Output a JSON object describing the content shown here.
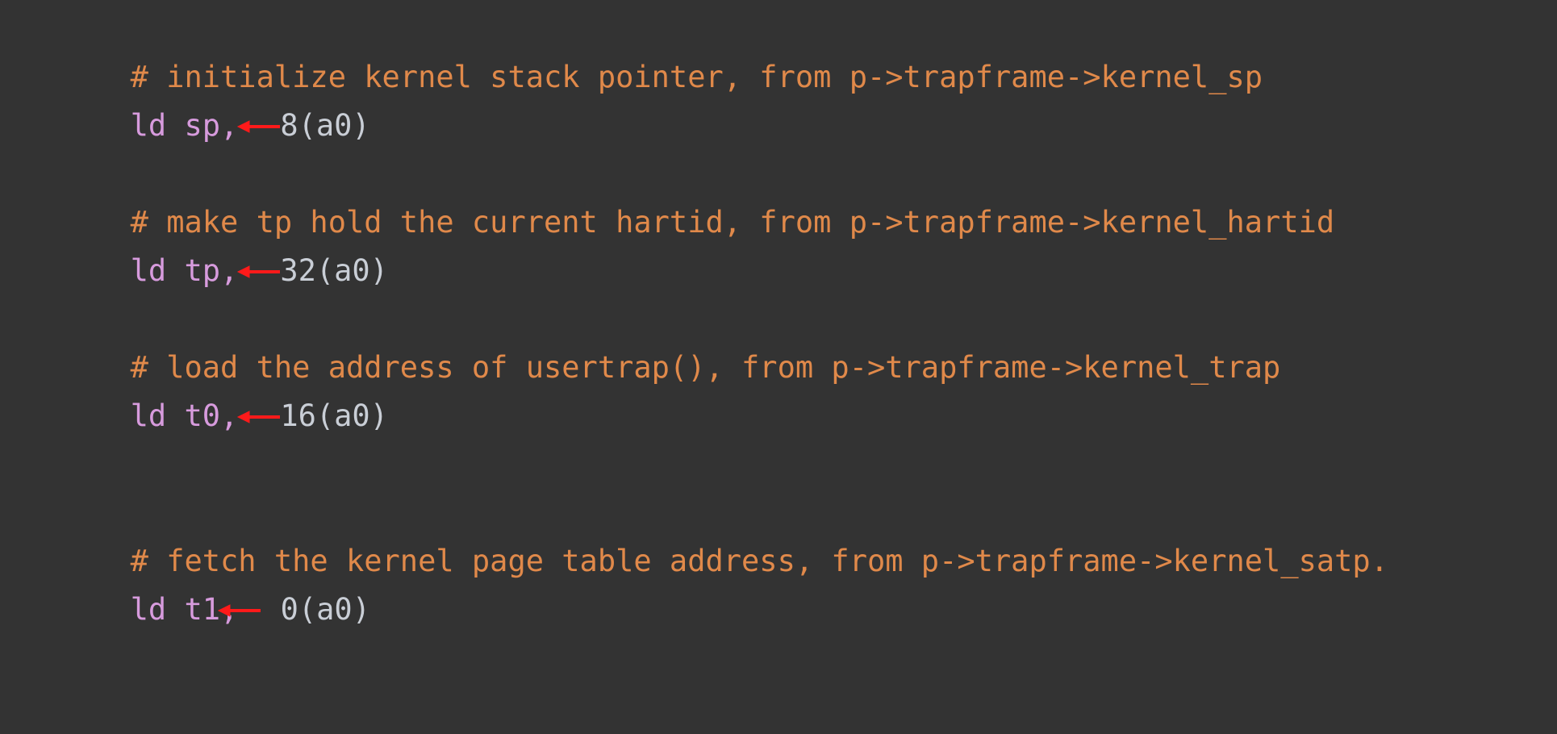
{
  "editor": {
    "background_color": "#333333",
    "comment_color": "#e0894a",
    "keyword_color": "#d79bdd",
    "operand_color": "#c9ced6",
    "annotation_color": "#ff1a1a",
    "language": "riscv-assembly"
  },
  "lines": [
    {
      "id": "line-1",
      "type": "comment",
      "text": "# initialize kernel stack pointer, from p->trapframe->kernel_sp"
    },
    {
      "id": "line-2",
      "type": "code",
      "keyword": "ld ",
      "register": "sp,",
      "operand": "8(a0)",
      "arrow": true,
      "full_text": "ld sp, 8(a0)"
    },
    {
      "id": "line-3",
      "type": "blank",
      "text": ""
    },
    {
      "id": "line-4",
      "type": "comment",
      "text": "# make tp hold the current hartid, from p->trapframe->kernel_hartid"
    },
    {
      "id": "line-5",
      "type": "code",
      "keyword": "ld ",
      "register": "tp,",
      "operand": "32(a0)",
      "arrow": true,
      "full_text": "ld tp, 32(a0)"
    },
    {
      "id": "line-6",
      "type": "blank",
      "text": ""
    },
    {
      "id": "line-7",
      "type": "comment",
      "text": "# load the address of usertrap(), from p->trapframe->kernel_trap"
    },
    {
      "id": "line-8",
      "type": "code",
      "keyword": "ld ",
      "register": "t0,",
      "operand": "16(a0)",
      "arrow": true,
      "full_text": "ld t0, 16(a0)"
    },
    {
      "id": "line-9",
      "type": "blank",
      "text": ""
    },
    {
      "id": "line-10",
      "type": "blank",
      "text": ""
    },
    {
      "id": "line-11",
      "type": "comment",
      "text": "# fetch the kernel page table address, from p->trapframe->kernel_satp."
    },
    {
      "id": "line-12",
      "type": "code",
      "keyword": "ld ",
      "register": "t1,",
      "operand": " 0(a0)",
      "arrow": true,
      "arrow_shift": -22,
      "full_text": "ld t1, 0(a0)"
    }
  ],
  "annotations": {
    "arrow_label": "left-arrow",
    "count": 4,
    "description": "red leftward arrows between register operand and memory offset"
  }
}
